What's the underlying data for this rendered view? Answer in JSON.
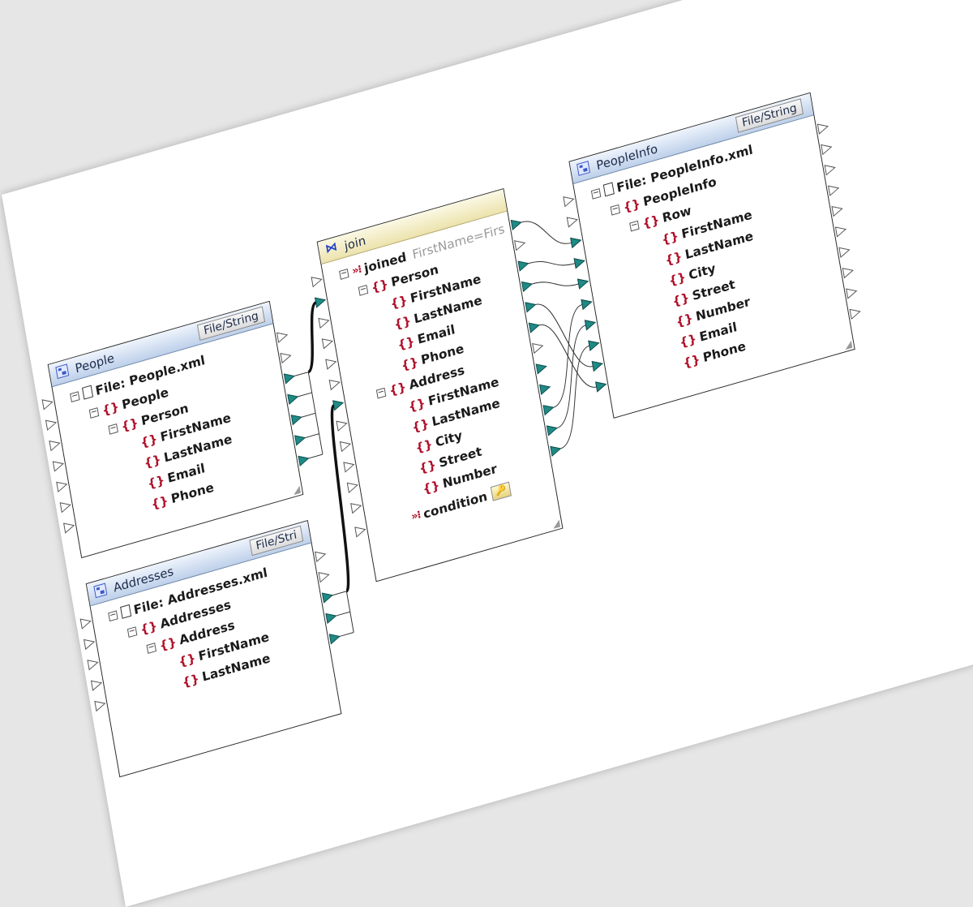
{
  "components": {
    "people": {
      "title": "People",
      "button": "File/String",
      "rows": [
        {
          "label": "File: People.xml",
          "icon": "file-icon"
        },
        {
          "label": "People",
          "icon": "element-icon"
        },
        {
          "label": "Person",
          "icon": "element-icon"
        },
        {
          "label": "FirstName",
          "icon": "element-icon"
        },
        {
          "label": "LastName",
          "icon": "element-icon"
        },
        {
          "label": "Email",
          "icon": "element-icon"
        },
        {
          "label": "Phone",
          "icon": "element-icon"
        }
      ]
    },
    "addresses": {
      "title": "Addresses",
      "button": "File/Stri",
      "rows": [
        {
          "label": "File: Addresses.xml",
          "icon": "file-icon"
        },
        {
          "label": "Addresses",
          "icon": "element-icon"
        },
        {
          "label": "Address",
          "icon": "element-icon"
        },
        {
          "label": "FirstName",
          "icon": "element-icon"
        },
        {
          "label": "LastName",
          "icon": "element-icon"
        }
      ]
    },
    "join": {
      "title": "join",
      "joined_label": "joined",
      "joined_hint": "FirstName=Firs",
      "rows": [
        {
          "label": "Person",
          "icon": "element-icon"
        },
        {
          "label": "FirstName",
          "icon": "element-icon"
        },
        {
          "label": "LastName",
          "icon": "element-icon"
        },
        {
          "label": "Email",
          "icon": "element-icon"
        },
        {
          "label": "Phone",
          "icon": "element-icon"
        },
        {
          "label": "Address",
          "icon": "element-icon"
        },
        {
          "label": "FirstName",
          "icon": "element-icon"
        },
        {
          "label": "LastName",
          "icon": "element-icon"
        },
        {
          "label": "City",
          "icon": "element-icon"
        },
        {
          "label": "Street",
          "icon": "element-icon"
        },
        {
          "label": "Number",
          "icon": "element-icon"
        }
      ],
      "condition_label": "condition"
    },
    "peopleinfo": {
      "title": "PeopleInfo",
      "button": "File/String",
      "rows": [
        {
          "label": "File: PeopleInfo.xml",
          "icon": "file-icon"
        },
        {
          "label": "PeopleInfo",
          "icon": "element-icon"
        },
        {
          "label": "Row",
          "icon": "element-icon"
        },
        {
          "label": "FirstName",
          "icon": "element-icon"
        },
        {
          "label": "LastName",
          "icon": "element-icon"
        },
        {
          "label": "City",
          "icon": "element-icon"
        },
        {
          "label": "Street",
          "icon": "element-icon"
        },
        {
          "label": "Number",
          "icon": "element-icon"
        },
        {
          "label": "Email",
          "icon": "element-icon"
        },
        {
          "label": "Phone",
          "icon": "element-icon"
        }
      ]
    }
  },
  "colors": {
    "connector_filled": "#1f8a86",
    "element_icon": "#b0102a",
    "header_blue": "#bed0ea",
    "header_join": "#ece3ad"
  }
}
